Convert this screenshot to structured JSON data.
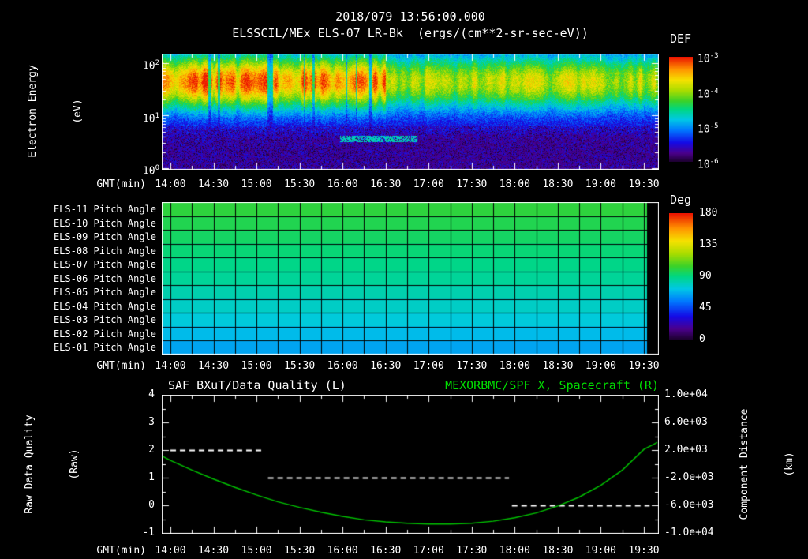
{
  "colors": {
    "background": "#000000",
    "text": "#ffffff",
    "accent_green": "#00dd00",
    "curve_green": "#00c400",
    "axis": "#ffffff"
  },
  "header": {
    "datetime": "2018/079 13:56:00.000",
    "title": "ELSSCIL/MEx ELS-07 LR-Bk  (ergs/(cm**2-sr-sec-eV))"
  },
  "time_axis": {
    "label": "GMT(min)",
    "ticks": [
      "14:00",
      "14:30",
      "15:00",
      "15:30",
      "16:00",
      "16:30",
      "17:00",
      "17:30",
      "18:00",
      "18:30",
      "19:00",
      "19:30"
    ],
    "tick_minutes": [
      0,
      30,
      60,
      90,
      120,
      150,
      180,
      210,
      240,
      270,
      300,
      330
    ]
  },
  "spectrogram_panel": {
    "ylabel_line1": "Electron Energy",
    "ylabel_line2": "(eV)",
    "y_tick_exponents": [
      2,
      1,
      0
    ],
    "colorbar_title": "DEF",
    "colorbar_tick_exponents": [
      -3,
      -4,
      -5,
      -6
    ]
  },
  "pitch_panel": {
    "colorbar_title": "Deg"
  },
  "quality_panel": {
    "left_title": "SAF_BXuT/Data Quality (L)",
    "right_title": "MEXORBMC/SPF X, Spacecraft (R)",
    "left_axis": {
      "label_line1": "Raw Data Quality",
      "label_line2": "(Raw)"
    },
    "right_axis": {
      "label_line1": "Component Distance",
      "label_line2": "(km)"
    }
  },
  "chart_data": [
    {
      "type": "heatmap",
      "panel": "electron-energy-spectrogram",
      "title": "ELSSCIL/MEx ELS-07 LR-Bk",
      "units": "ergs/(cm**2-sr-sec-eV)",
      "xlabel": "GMT(min)",
      "x_ticks": [
        "14:00",
        "14:30",
        "15:00",
        "15:30",
        "16:00",
        "16:30",
        "17:00",
        "17:30",
        "18:00",
        "18:30",
        "19:00",
        "19:30"
      ],
      "ylabel": "Electron Energy (eV)",
      "y_scale": "log",
      "y_tick_values_ev": [
        100,
        10,
        1
      ],
      "colorbar_label": "DEF",
      "colorbar_tick_values": [
        "1e-3",
        "1e-4",
        "1e-5",
        "1e-6"
      ],
      "description": "Turbulent electron spectrogram: intense red/yellow flux band at ~20-100 eV from 14:00 to ~16:30 with brief dropouts, moderating to green/yellow flux until 19:30; blue low-flux region below ~10 eV with dark purple speckle below ~4 eV and a faint cyan streak near 3-5 eV around 16:00-16:50",
      "features": {
        "band_center_log10ev": 1.65,
        "band_sigma": 0.55,
        "band_plateau_above": 1.2,
        "band_plateau_value": 0.35,
        "base_level": 0.13,
        "noise": 0.15,
        "intense_until_min": 150,
        "intense_amp_range": [
          0.66,
          1.0
        ],
        "dropout_fraction": 0.14,
        "moderate_amp_range": [
          0.52,
          0.74
        ],
        "speckle_below_log10ev": 0.6,
        "purple_speckle_after_min": 150,
        "cyan_streak": {
          "t_range_min": [
            118,
            172
          ],
          "log10ev": 0.56
        }
      }
    },
    {
      "type": "heatmap",
      "panel": "pitch-angles",
      "rows": [
        "ELS-11 Pitch Angle",
        "ELS-10 Pitch Angle",
        "ELS-09 Pitch Angle",
        "ELS-08 Pitch Angle",
        "ELS-07 Pitch Angle",
        "ELS-06 Pitch Angle",
        "ELS-05 Pitch Angle",
        "ELS-04 Pitch Angle",
        "ELS-03 Pitch Angle",
        "ELS-02 Pitch Angle",
        "ELS-01 Pitch Angle"
      ],
      "row_values_deg": [
        101,
        98,
        95,
        92,
        89,
        86,
        82,
        78,
        74,
        69,
        64
      ],
      "value_range_deg": [
        0,
        180
      ],
      "colorbar_label": "Deg",
      "colorbar_ticks_deg": [
        180,
        135,
        90,
        45,
        0
      ],
      "xlabel": "GMT(min)",
      "x_ticks": [
        "14:00",
        "14:30",
        "15:00",
        "15:30",
        "16:00",
        "16:30",
        "17:00",
        "17:30",
        "18:00",
        "18:30",
        "19:00",
        "19:30"
      ],
      "grid_interval_min": 15,
      "no_data_after_min": 332
    },
    {
      "type": "line",
      "panel": "data-quality-and-spacecraft-distance",
      "xlabel": "GMT(min)",
      "x_ticks": [
        "14:00",
        "14:30",
        "15:00",
        "15:30",
        "16:00",
        "16:30",
        "17:00",
        "17:30",
        "18:00",
        "18:30",
        "19:00",
        "19:30"
      ],
      "x_range_min": [
        -6,
        340
      ],
      "left_axis": {
        "label": "Raw Data Quality (Raw)",
        "range": [
          -1,
          4
        ],
        "ticks": [
          4,
          3,
          2,
          1,
          0,
          -1
        ]
      },
      "right_axis": {
        "label": "Component Distance (km)",
        "range": [
          -10000,
          10000
        ],
        "ticks": [
          "1.0e+04",
          "6.0e+03",
          "2.0e+03",
          "-2.0e+03",
          "-6.0e+03",
          "-1.0e+04"
        ]
      },
      "series": [
        {
          "name": "SAF_BXuT/Data Quality (L)",
          "axis": "left",
          "style": "dashed",
          "color": "#ffffff",
          "segments": [
            {
              "start_min": 0,
              "end_min": 66,
              "value": 2
            },
            {
              "start_min": 68,
              "end_min": 236,
              "value": 1
            },
            {
              "start_min": 238,
              "end_min": 334,
              "value": 0
            }
          ]
        },
        {
          "name": "MEXORBMC/SPF X, Spacecraft (R)",
          "axis": "right",
          "style": "solid",
          "color": "#00c400",
          "x_minutes": [
            -6,
            0,
            15,
            30,
            45,
            60,
            75,
            90,
            105,
            120,
            135,
            150,
            165,
            180,
            195,
            210,
            225,
            240,
            255,
            270,
            285,
            300,
            315,
            330,
            340
          ],
          "y_km": [
            1100,
            500,
            -900,
            -2200,
            -3400,
            -4500,
            -5500,
            -6300,
            -7000,
            -7600,
            -8100,
            -8400,
            -8600,
            -8700,
            -8700,
            -8600,
            -8300,
            -7800,
            -7100,
            -6100,
            -4800,
            -3100,
            -900,
            2100,
            3100
          ]
        }
      ]
    }
  ]
}
